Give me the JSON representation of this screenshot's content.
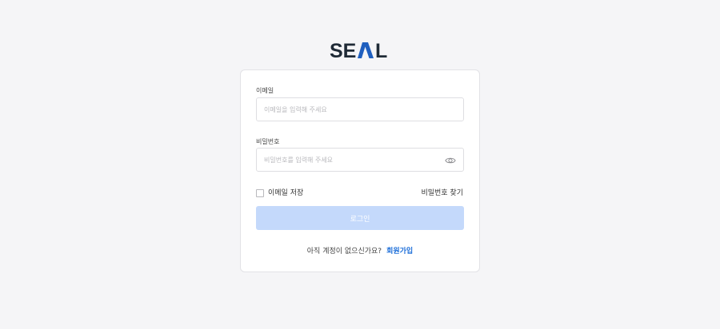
{
  "brand": {
    "logo_text": "SEAL",
    "colors": {
      "dark": "#1f2a36",
      "accent": "#1f5fbf"
    }
  },
  "login_form": {
    "email": {
      "label": "이메일",
      "placeholder": "이메일을 입력해 주세요",
      "value": ""
    },
    "password": {
      "label": "비밀번호",
      "placeholder": "비밀번호를 입력해 주세요",
      "value": "",
      "toggle_icon": "eye-icon"
    },
    "remember_email": {
      "label": "이메일 저장",
      "checked": false
    },
    "find_password_label": "비밀번호 찾기",
    "submit": {
      "label": "로그인",
      "enabled": false,
      "color": "#c4d9fb"
    },
    "signup": {
      "question": "아직 계정이 없으신가요?",
      "link_label": "회원가입",
      "link_color": "#1e6fd9"
    }
  }
}
